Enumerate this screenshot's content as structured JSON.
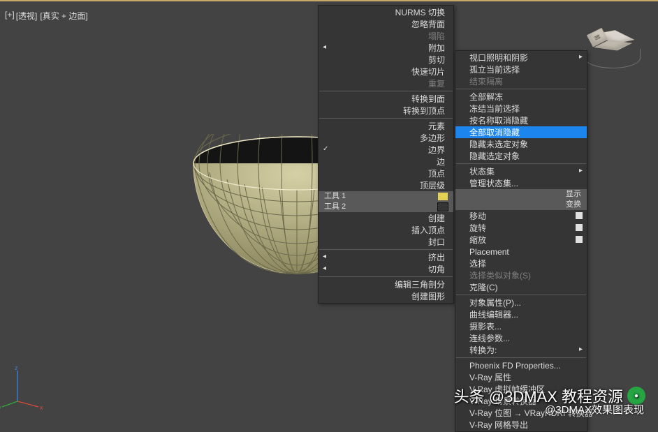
{
  "viewport": {
    "label_plus": "[+]",
    "label_view": "[透视]",
    "label_shade": "[真实 + 边面]",
    "cube_face": "前"
  },
  "menu1": {
    "items": [
      {
        "label": "NURMS 切换",
        "arrow": false,
        "type": "item"
      },
      {
        "label": "忽略背面",
        "type": "item"
      },
      {
        "label": "塌陷",
        "type": "item",
        "disabled": true
      },
      {
        "label": "附加",
        "type": "item",
        "arrow_l": true
      },
      {
        "label": "剪切",
        "type": "item"
      },
      {
        "label": "快速切片",
        "type": "item"
      },
      {
        "label": "重复",
        "type": "item",
        "disabled": true
      },
      {
        "type": "sep"
      },
      {
        "label": "转换到面",
        "type": "item"
      },
      {
        "label": "转换到顶点",
        "type": "item"
      },
      {
        "type": "sep"
      },
      {
        "label": "元素",
        "type": "item"
      },
      {
        "label": "多边形",
        "type": "item"
      },
      {
        "label": "边界",
        "type": "item",
        "checked": true
      },
      {
        "label": "边",
        "type": "item"
      },
      {
        "label": "顶点",
        "type": "item"
      },
      {
        "label": "顶层级",
        "type": "item"
      },
      {
        "type": "bar",
        "label": "工具 1",
        "swatch": "y"
      },
      {
        "type": "bar",
        "label": "工具 2",
        "swatch": "b"
      },
      {
        "label": "创建",
        "type": "item"
      },
      {
        "label": "插入顶点",
        "type": "item"
      },
      {
        "label": "封口",
        "type": "item"
      },
      {
        "type": "sep"
      },
      {
        "label": "挤出",
        "type": "item",
        "arrow_l": true
      },
      {
        "label": "切角",
        "type": "item",
        "arrow_l": true
      },
      {
        "type": "sep"
      },
      {
        "label": "编辑三角剖分",
        "type": "item"
      },
      {
        "label": "创建图形",
        "type": "item"
      }
    ]
  },
  "menu2": {
    "items": [
      {
        "label": "视口照明和阴影",
        "arrow": true
      },
      {
        "label": "孤立当前选择",
        "type": "item"
      },
      {
        "label": "结束隔离",
        "type": "item",
        "disabled": true
      },
      {
        "type": "sep"
      },
      {
        "label": "全部解冻",
        "type": "item"
      },
      {
        "label": "冻结当前选择",
        "type": "item"
      },
      {
        "label": "按名称取消隐藏",
        "type": "item"
      },
      {
        "label": "全部取消隐藏",
        "type": "item",
        "hl": true
      },
      {
        "label": "隐藏未选定对象",
        "type": "item"
      },
      {
        "label": "隐藏选定对象",
        "type": "item"
      },
      {
        "type": "sep"
      },
      {
        "label": "状态集",
        "arrow": true
      },
      {
        "label": "管理状态集...",
        "type": "item"
      },
      {
        "type": "bar",
        "barlabel_r": "显示"
      },
      {
        "type": "bar",
        "barlabel_r": "变换"
      },
      {
        "label": "移动",
        "pbox": true
      },
      {
        "label": "旋转",
        "pbox": true
      },
      {
        "label": "缩放",
        "pbox": true
      },
      {
        "label": "Placement",
        "type": "item"
      },
      {
        "label": "选择",
        "type": "item"
      },
      {
        "label": "选择类似对象(S)",
        "type": "item",
        "disabled": true
      },
      {
        "label": "克隆(C)",
        "type": "item"
      },
      {
        "type": "sep"
      },
      {
        "label": "对象属性(P)...",
        "type": "item"
      },
      {
        "label": "曲线编辑器...",
        "type": "item"
      },
      {
        "label": "摄影表...",
        "type": "item"
      },
      {
        "label": "连线参数...",
        "type": "item"
      },
      {
        "label": "转换为:",
        "arrow": true
      },
      {
        "type": "sep"
      },
      {
        "label": "Phoenix FD Properties...",
        "type": "item"
      },
      {
        "label": "V-Ray 属性",
        "type": "item"
      },
      {
        "label": "V-Ray 虚拟帧缓冲区",
        "type": "item"
      },
      {
        "label": "V-Ray 场景转换器",
        "type": "item"
      },
      {
        "label": "V-Ray 位图 → VRayHDRI 转换器",
        "type": "item"
      },
      {
        "label": "V-Ray 网格导出",
        "type": "item"
      }
    ]
  },
  "watermark": {
    "line1": "头条 @3DMAX 教程资源",
    "sub": "@3DMAX效果图表现"
  }
}
